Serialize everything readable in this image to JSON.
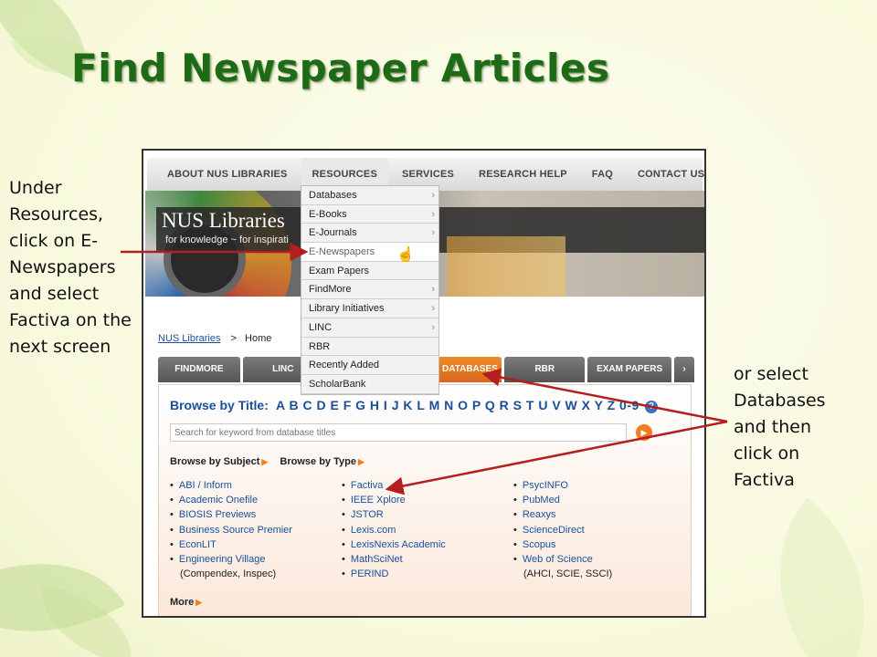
{
  "slide": {
    "title": "Find Newspaper Articles",
    "left_callout": "Under Resources, click on E-Newspapers and select Factiva on the next screen",
    "right_callout": "or select Databases and then click on Factiva"
  },
  "colors": {
    "title_green": "#1f6a16",
    "arrow_red": "#b51e1e",
    "link_blue": "#1a4f9c",
    "tab_orange": "#f08a2a"
  },
  "site": {
    "topnav": [
      "ABOUT NUS LIBRARIES",
      "RESOURCES",
      "SERVICES",
      "RESEARCH HELP",
      "FAQ",
      "CONTACT US"
    ],
    "banner": {
      "brand": "NUS Libraries",
      "tagline": "for knowledge ~ for inspirati"
    },
    "dropdown": [
      {
        "label": "Databases",
        "chevron": "›"
      },
      {
        "label": "E-Books",
        "chevron": "›"
      },
      {
        "label": "E-Journals",
        "chevron": "›"
      },
      {
        "label": "E-Newspapers",
        "chevron": ""
      },
      {
        "label": "Exam Papers",
        "chevron": ""
      },
      {
        "label": "FindMore",
        "chevron": "›"
      },
      {
        "label": "Library Initiatives",
        "chevron": "›"
      },
      {
        "label": "LINC",
        "chevron": "›"
      },
      {
        "label": "RBR",
        "chevron": ""
      },
      {
        "label": "Recently Added",
        "chevron": ""
      },
      {
        "label": "ScholarBank",
        "chevron": ""
      }
    ],
    "breadcrumb": {
      "link": "NUS Libraries",
      "separator": ">",
      "current": "Home"
    },
    "tabs": [
      "FINDMORE",
      "LINC",
      "",
      "DATABASES",
      "RBR",
      "EXAM PAPERS",
      "›"
    ],
    "browse": {
      "title_label": "Browse by Title:",
      "letters": "A B C D E F G H I J K L M N O P Q R S T U V W X Y Z 0-9",
      "help": "?",
      "search_placeholder": "Search for keyword from database titles",
      "by_subject": "Browse by Subject",
      "by_type": "Browse by Type",
      "col1": [
        "ABI / Inform",
        "Academic Onefile",
        "BIOSIS Previews",
        "Business Source Premier",
        "EconLIT",
        "Engineering Village"
      ],
      "col1_sub": "(Compendex, Inspec)",
      "col2": [
        "Factiva",
        "IEEE Xplore",
        "JSTOR",
        "Lexis.com",
        "LexisNexis Academic",
        "MathSciNet",
        "PERIND"
      ],
      "col3": [
        "PsycINFO",
        "PubMed",
        "Reaxys",
        "ScienceDirect",
        "Scopus",
        "Web of Science"
      ],
      "col3_sub": "(AHCI, SCIE, SSCI)",
      "more": "More"
    }
  }
}
